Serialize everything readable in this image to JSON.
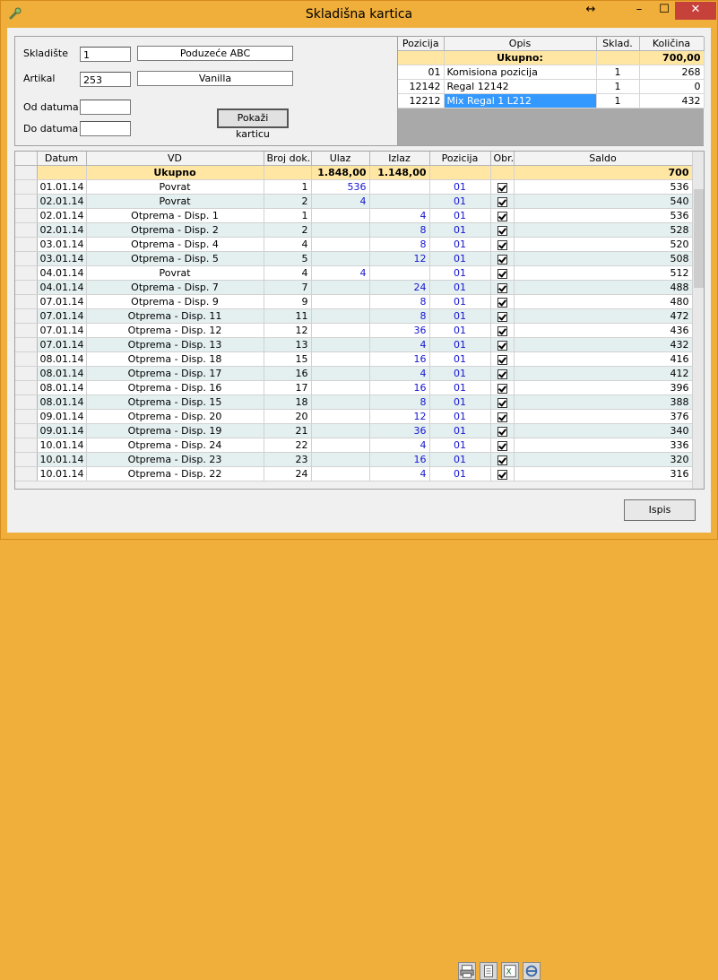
{
  "window": {
    "title": "Skladišna kartica"
  },
  "colors": {
    "frame": "#f0ae3a",
    "total_row": "#ffe6a3",
    "alt_row": "#e4efef",
    "selection": "#3399ff",
    "value_blue": "#1515d0",
    "close": "#c7413b"
  },
  "icons": {
    "app": "wrench-icon",
    "restore": "resize-arrows-icon",
    "minimize": "minimize-icon",
    "maximize": "maximize-icon",
    "close": "close-icon"
  },
  "filters": {
    "skladiste_label": "Skladište",
    "skladiste_value": "1",
    "skladiste_name": "Poduzeće ABC",
    "artikal_label": "Artikal",
    "artikal_value": "253",
    "artikal_name": "Vanilla",
    "od_datuma_label": "Od datuma",
    "od_datuma_value": "",
    "do_datuma_label": "Do datuma",
    "do_datuma_value": "",
    "show_button": "Pokaži karticu"
  },
  "positions": {
    "headers": [
      "Pozicija",
      "Opis",
      "Sklad.",
      "Količina"
    ],
    "total": {
      "label": "Ukupno:",
      "kolicina": "700,00"
    },
    "rows": [
      {
        "pozicija": "01",
        "opis": "Komisiona pozicija",
        "sklad": "1",
        "kolicina": "268"
      },
      {
        "pozicija": "12142",
        "opis": "Regal 12142",
        "sklad": "1",
        "kolicina": "0"
      },
      {
        "pozicija": "12212",
        "opis": "Mix Regal 1 L212",
        "sklad": "1",
        "kolicina": "432"
      }
    ]
  },
  "ledger": {
    "headers": [
      "Datum",
      "VD",
      "Broj dok.",
      "Ulaz",
      "Izlaz",
      "Pozicija",
      "Obr.",
      "Saldo"
    ],
    "total": {
      "label": "Ukupno",
      "ulaz": "1.848,00",
      "izlaz": "1.148,00",
      "saldo": "700"
    },
    "rows": [
      {
        "datum": "01.01.14",
        "vd": "Povrat",
        "broj": "1",
        "ulaz": "536",
        "izlaz": "",
        "pozicija": "01",
        "saldo": "536"
      },
      {
        "datum": "02.01.14",
        "vd": "Povrat",
        "broj": "2",
        "ulaz": "4",
        "izlaz": "",
        "pozicija": "01",
        "saldo": "540"
      },
      {
        "datum": "02.01.14",
        "vd": "Otprema - Disp. 1",
        "broj": "1",
        "ulaz": "",
        "izlaz": "4",
        "pozicija": "01",
        "saldo": "536"
      },
      {
        "datum": "02.01.14",
        "vd": "Otprema - Disp. 2",
        "broj": "2",
        "ulaz": "",
        "izlaz": "8",
        "pozicija": "01",
        "saldo": "528"
      },
      {
        "datum": "03.01.14",
        "vd": "Otprema - Disp. 4",
        "broj": "4",
        "ulaz": "",
        "izlaz": "8",
        "pozicija": "01",
        "saldo": "520"
      },
      {
        "datum": "03.01.14",
        "vd": "Otprema - Disp. 5",
        "broj": "5",
        "ulaz": "",
        "izlaz": "12",
        "pozicija": "01",
        "saldo": "508"
      },
      {
        "datum": "04.01.14",
        "vd": "Povrat",
        "broj": "4",
        "ulaz": "4",
        "izlaz": "",
        "pozicija": "01",
        "saldo": "512"
      },
      {
        "datum": "04.01.14",
        "vd": "Otprema - Disp. 7",
        "broj": "7",
        "ulaz": "",
        "izlaz": "24",
        "pozicija": "01",
        "saldo": "488"
      },
      {
        "datum": "07.01.14",
        "vd": "Otprema - Disp. 9",
        "broj": "9",
        "ulaz": "",
        "izlaz": "8",
        "pozicija": "01",
        "saldo": "480"
      },
      {
        "datum": "07.01.14",
        "vd": "Otprema - Disp. 11",
        "broj": "11",
        "ulaz": "",
        "izlaz": "8",
        "pozicija": "01",
        "saldo": "472"
      },
      {
        "datum": "07.01.14",
        "vd": "Otprema - Disp. 12",
        "broj": "12",
        "ulaz": "",
        "izlaz": "36",
        "pozicija": "01",
        "saldo": "436"
      },
      {
        "datum": "07.01.14",
        "vd": "Otprema - Disp. 13",
        "broj": "13",
        "ulaz": "",
        "izlaz": "4",
        "pozicija": "01",
        "saldo": "432"
      },
      {
        "datum": "08.01.14",
        "vd": "Otprema - Disp. 18",
        "broj": "15",
        "ulaz": "",
        "izlaz": "16",
        "pozicija": "01",
        "saldo": "416"
      },
      {
        "datum": "08.01.14",
        "vd": "Otprema - Disp. 17",
        "broj": "16",
        "ulaz": "",
        "izlaz": "4",
        "pozicija": "01",
        "saldo": "412"
      },
      {
        "datum": "08.01.14",
        "vd": "Otprema - Disp. 16",
        "broj": "17",
        "ulaz": "",
        "izlaz": "16",
        "pozicija": "01",
        "saldo": "396"
      },
      {
        "datum": "08.01.14",
        "vd": "Otprema - Disp. 15",
        "broj": "18",
        "ulaz": "",
        "izlaz": "8",
        "pozicija": "01",
        "saldo": "388"
      },
      {
        "datum": "09.01.14",
        "vd": "Otprema - Disp. 20",
        "broj": "20",
        "ulaz": "",
        "izlaz": "12",
        "pozicija": "01",
        "saldo": "376"
      },
      {
        "datum": "09.01.14",
        "vd": "Otprema - Disp. 19",
        "broj": "21",
        "ulaz": "",
        "izlaz": "36",
        "pozicija": "01",
        "saldo": "340"
      },
      {
        "datum": "10.01.14",
        "vd": "Otprema - Disp. 24",
        "broj": "22",
        "ulaz": "",
        "izlaz": "4",
        "pozicija": "01",
        "saldo": "336"
      },
      {
        "datum": "10.01.14",
        "vd": "Otprema - Disp. 23",
        "broj": "23",
        "ulaz": "",
        "izlaz": "16",
        "pozicija": "01",
        "saldo": "320"
      },
      {
        "datum": "10.01.14",
        "vd": "Otprema - Disp. 22",
        "broj": "24",
        "ulaz": "",
        "izlaz": "4",
        "pozicija": "01",
        "saldo": "316"
      }
    ]
  },
  "toolbar": {
    "icons": [
      "printer-icon",
      "document-icon",
      "excel-icon",
      "internet-explorer-icon"
    ],
    "print_button": "Ispis"
  }
}
